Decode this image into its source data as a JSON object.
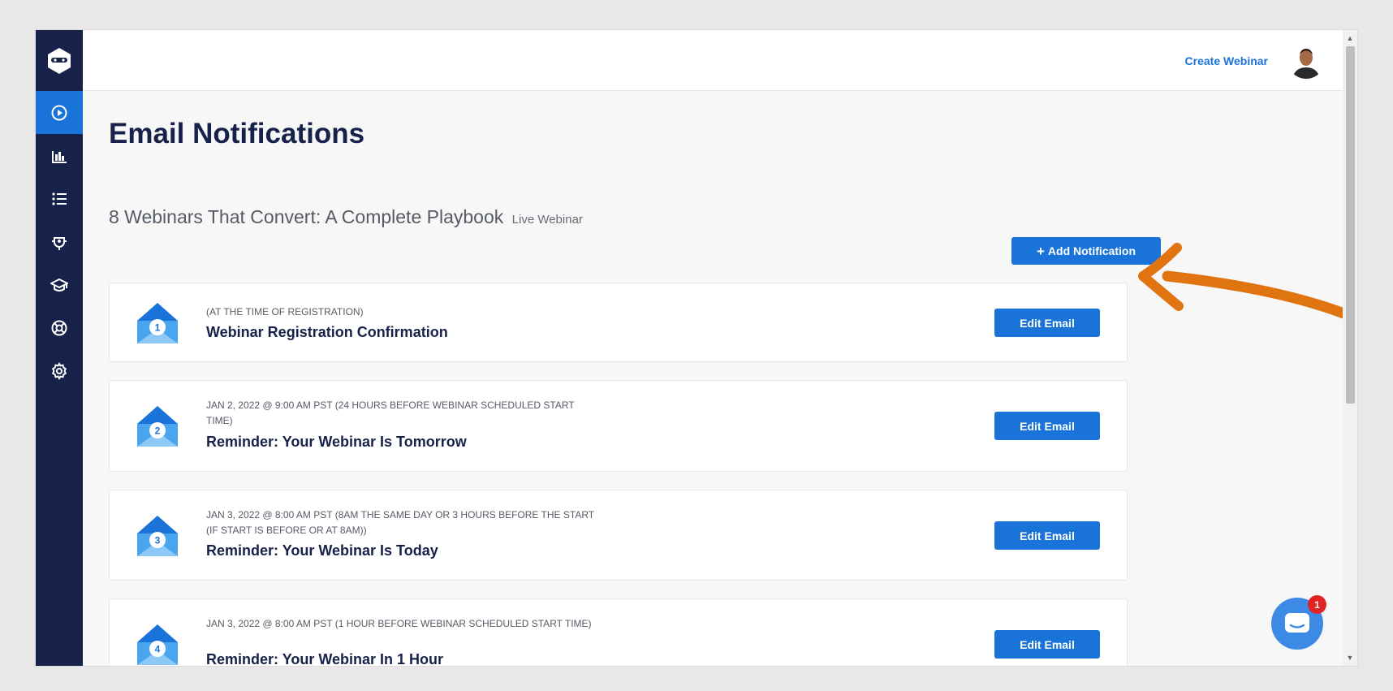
{
  "header": {
    "create_link": "Create Webinar"
  },
  "sidebar": {
    "items": [
      {
        "icon": "play-circle-icon",
        "active": true
      },
      {
        "icon": "bar-chart-icon",
        "active": false
      },
      {
        "icon": "list-icon",
        "active": false
      },
      {
        "icon": "integrations-icon",
        "active": false
      },
      {
        "icon": "graduation-cap-icon",
        "active": false
      },
      {
        "icon": "lifebuoy-icon",
        "active": false
      },
      {
        "icon": "gear-icon",
        "active": false
      }
    ]
  },
  "page": {
    "title": "Email Notifications",
    "webinar_name": "8 Webinars That Convert: A Complete Playbook",
    "webinar_type": "Live Webinar",
    "add_button": "Add Notification"
  },
  "notifications": [
    {
      "number": "1",
      "meta": "(AT THE TIME OF REGISTRATION)",
      "title": "Webinar Registration Confirmation",
      "button": "Edit Email"
    },
    {
      "number": "2",
      "meta": "JAN 2, 2022 @ 9:00 AM PST (24 HOURS BEFORE WEBINAR SCHEDULED START TIME)",
      "title": "Reminder: Your Webinar Is Tomorrow",
      "button": "Edit Email"
    },
    {
      "number": "3",
      "meta": "JAN 3, 2022 @ 8:00 AM PST (8AM THE SAME DAY OR 3 HOURS BEFORE THE START (IF START IS BEFORE OR AT 8AM))",
      "title": "Reminder: Your Webinar Is Today",
      "button": "Edit Email"
    },
    {
      "number": "4",
      "meta": "JAN 3, 2022 @ 8:00 AM PST (1 HOUR BEFORE WEBINAR SCHEDULED START TIME)",
      "title": "Reminder: Your Webinar In 1 Hour",
      "button": "Edit Email"
    }
  ],
  "chat": {
    "badge_count": "1"
  },
  "colors": {
    "sidebar": "#17224a",
    "accent": "#1a73d9",
    "arrow": "#e07410",
    "badge": "#e02424"
  }
}
